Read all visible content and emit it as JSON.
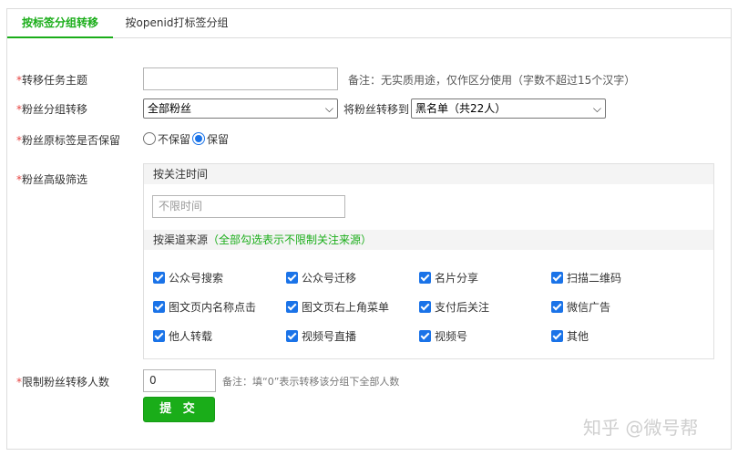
{
  "tabs": [
    {
      "label": "按标签分组转移"
    },
    {
      "label": "按openid打标签分组"
    }
  ],
  "form": {
    "task": {
      "required_mark": "*",
      "label": "转移任务主题",
      "value": "",
      "note": "备注：无实质用途，仅作区分使用（字数不超过15个汉字）"
    },
    "group": {
      "required_mark": "*",
      "label": "粉丝分组转移",
      "selected": "全部粉丝",
      "transfer_label": "将粉丝转移到",
      "target_selected": "黑名单（共22人）"
    },
    "keep_tags": {
      "required_mark": "*",
      "label": "粉丝原标签是否保留",
      "options": [
        {
          "label": "不保留",
          "checked": false
        },
        {
          "label": "保留",
          "checked": true
        }
      ]
    },
    "advanced": {
      "required_mark": "*",
      "label": "粉丝高级筛选",
      "follow_time_header": "按关注时间",
      "follow_time_placeholder": "不限时间",
      "channel_header": "按渠道来源",
      "channel_note": "（全部勾选表示不限制关注来源）",
      "channels": [
        {
          "label": "公众号搜索",
          "checked": true
        },
        {
          "label": "公众号迁移",
          "checked": true
        },
        {
          "label": "名片分享",
          "checked": true
        },
        {
          "label": "扫描二维码",
          "checked": true
        },
        {
          "label": "图文页内名称点击",
          "checked": true
        },
        {
          "label": "图文页右上角菜单",
          "checked": true
        },
        {
          "label": "支付后关注",
          "checked": true
        },
        {
          "label": "微信广告",
          "checked": true
        },
        {
          "label": "他人转载",
          "checked": true
        },
        {
          "label": "视频号直播",
          "checked": true
        },
        {
          "label": "视频号",
          "checked": true
        },
        {
          "label": "其他",
          "checked": true
        }
      ]
    },
    "limit": {
      "required_mark": "*",
      "label": "限制粉丝转移人数",
      "value": "0",
      "note": "备注：填“0”表示转移该分组下全部人数"
    },
    "submit_label": "提 交"
  },
  "watermark": "知乎 @微号帮",
  "colors": {
    "accent_green": "#1aad19",
    "check_blue": "#1a73e8",
    "required_red": "#e64340"
  }
}
